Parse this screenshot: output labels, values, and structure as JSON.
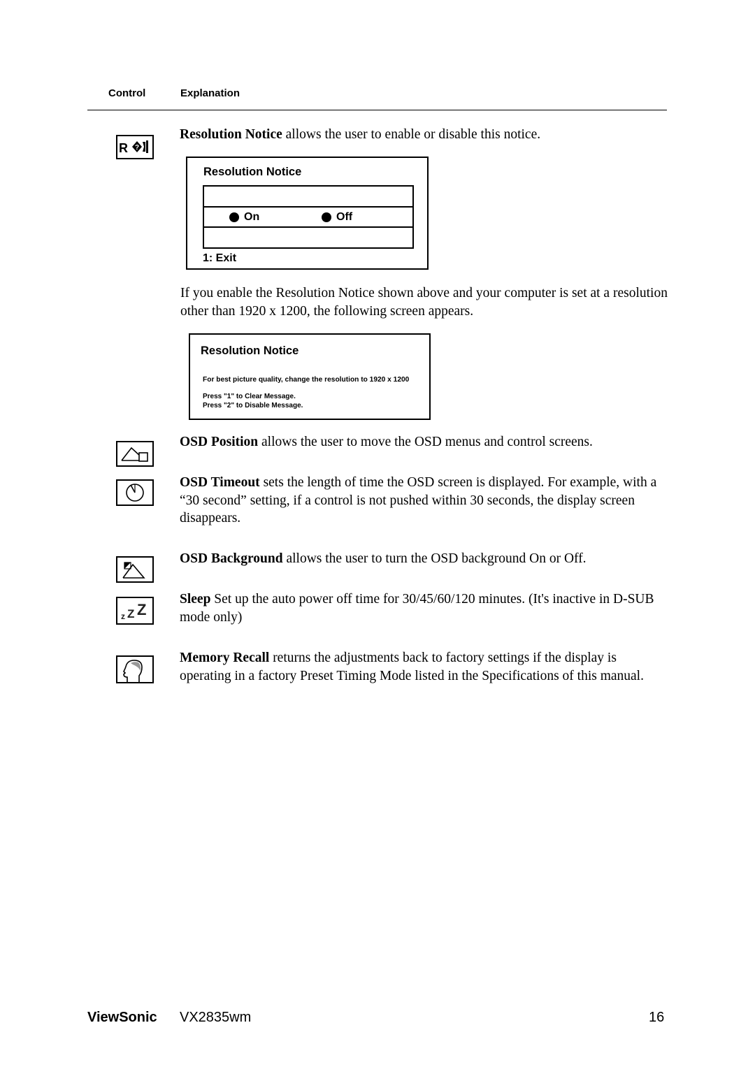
{
  "header": {
    "col_control": "Control",
    "col_explanation": "Explanation"
  },
  "items": [
    {
      "icon": "resolution-notice-icon",
      "term": "Resolution Notice",
      "text": " allows the user to enable or disable this notice."
    },
    {
      "icon": "osd-position-icon",
      "term": "OSD Position",
      "text": " allows the user to move the OSD menus and control screens."
    },
    {
      "icon": "osd-timeout-icon",
      "term": "OSD Timeout",
      "text": " sets the length of time the OSD screen is displayed. For example, with a “30 second” setting, if a control is not pushed within 30 seconds, the display screen disappears."
    },
    {
      "icon": "osd-background-icon",
      "term": "OSD Background",
      "text": " allows the user to turn the OSD background On or Off."
    },
    {
      "icon": "sleep-icon",
      "term": "Sleep",
      "text": " Set up the auto power off time for 30/45/60/120 minutes. (It's inactive in D-SUB mode only)"
    },
    {
      "icon": "memory-recall-icon",
      "term": "Memory Recall",
      "text": " returns the adjustments back to factory settings if the display is operating in a factory Preset Timing Mode listed in the Specifications of this manual."
    }
  ],
  "osd_menu": {
    "title": "Resolution Notice",
    "options": [
      "On",
      "Off"
    ],
    "exit_label": "1: Exit"
  },
  "interstitial_paragraph": "If you enable the Resolution Notice shown above and your computer is set at a resolution other than 1920 x 1200, the following screen appears.",
  "notice_screen": {
    "title": "Resolution Notice",
    "message": "For best picture quality, change the resolution to 1920 x 1200",
    "line1": "Press \"1\" to Clear Message.",
    "line2": "Press \"2\" to Disable Message."
  },
  "footer": {
    "brand": "ViewSonic",
    "model": "VX2835wm",
    "page_number": "16"
  }
}
